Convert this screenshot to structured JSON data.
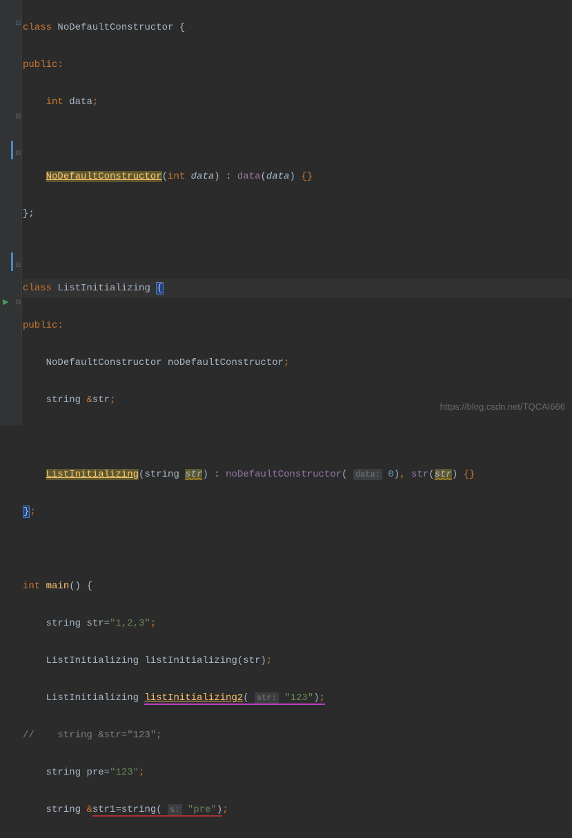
{
  "code": {
    "l1": {
      "class_kw": "class",
      "name": "NoDefaultConstructor",
      "brace": "{"
    },
    "l2": {
      "access": "public:"
    },
    "l3": {
      "type": "int",
      "name": "data",
      "semi": ";"
    },
    "l5": {
      "ctor": "NoDefaultConstructor",
      "lp": "(",
      "ptype": "int",
      "pname": "data",
      "rp": ")",
      "colon": ":",
      "field": "data",
      "lp2": "(",
      "arg": "data",
      "rp2": ")",
      "braces": "{}"
    },
    "l6": {
      "close": "};"
    },
    "l8": {
      "class_kw": "class",
      "name": "ListInitializing",
      "brace": "{"
    },
    "l9": {
      "access": "public:"
    },
    "l10": {
      "type": "NoDefaultConstructor",
      "name": "noDefaultConstructor",
      "semi": ";"
    },
    "l11": {
      "type": "string",
      "amp": "&",
      "name": "str",
      "semi": ";"
    },
    "l13": {
      "ctor": "ListInitializing",
      "lp": "(",
      "ptype": "string",
      "pname": "str",
      "rp": ")",
      "colon": ":",
      "f1": "noDefaultConstructor",
      "lp2": "(",
      "hint1": "data:",
      "arg1": "0",
      "rp2": ")",
      "comma": ",",
      "f2": "str",
      "lp3": "(",
      "arg2": "str",
      "rp3": ")",
      "braces": "{}"
    },
    "l14": {
      "close": "};"
    },
    "l16": {
      "ret": "int",
      "name": "main",
      "parens": "()",
      "brace": "{"
    },
    "l17": {
      "type": "string",
      "name": "str",
      "eq": "=",
      "val": "\"1,2,3\"",
      "semi": ";"
    },
    "l18": {
      "type": "ListInitializing",
      "name": "listInitializing",
      "lp": "(",
      "arg": "str",
      "rp": ")",
      "semi": ";"
    },
    "l19": {
      "type": "ListInitializing",
      "name": "listInitializing2",
      "lp": "(",
      "hint": "str:",
      "arg": "\"123\"",
      "rp": ")",
      "semi": ";"
    },
    "l20": {
      "text": "//    string &str=\"123\";"
    },
    "l21": {
      "type": "string",
      "name": "pre",
      "eq": "=",
      "val": "\"123\"",
      "semi": ";"
    },
    "l22": {
      "type": "string",
      "amp": "&",
      "name": "str1",
      "eq": "=",
      "call": "string",
      "lp": "(",
      "hint": "s:",
      "arg": "\"pre\"",
      "rp": ")",
      "semi": ";"
    }
  },
  "watermark": "https://blog.csdn.net/TQCAI666"
}
